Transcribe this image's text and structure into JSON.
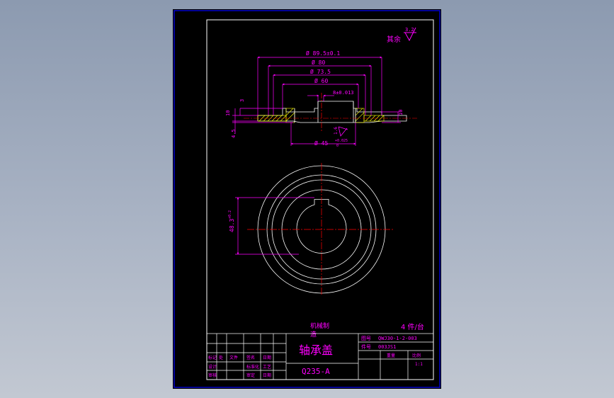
{
  "drawing": {
    "roughness_rest": "其余",
    "roughness_rest_value": "3.2",
    "roughness_face_value": "1.6",
    "dim_outer_flange": "Ø 89.5±0.1",
    "dim_bolt_circle": "Ø 80",
    "dim_spigot": "Ø 73.5",
    "dim_hub": "Ø 60",
    "dim_keyway_width": "8±0.013",
    "dim_bore": "Ø 45",
    "dim_bore_tol_upper": "+0.025",
    "dim_bore_tol_lower": "0",
    "dim_height_left": "10",
    "dim_step_left": "3",
    "dim_bottom_left": "4.5",
    "dim_height_right": "10",
    "dim_keyway_depth": "48.3",
    "dim_keyway_depth_tol": "+0.2"
  },
  "titleblock": {
    "machine_name": "机械制",
    "machine_name2": "造",
    "quantity": "4 件/台",
    "part_name": "轴承盖",
    "material": "Q235-A",
    "drawing_no_label": "图号",
    "drawing_no": "QWJ30-1-2-003",
    "part_no_label": "件号",
    "part_no": "003JS1",
    "scale": "1:1",
    "header_weight": "重量",
    "header_scale": "比例",
    "sign_row1": [
      "标记",
      "处",
      "文件",
      "签名",
      "日期"
    ],
    "sign_row2": [
      "设计",
      "",
      "标准化"
    ],
    "sign_row3": [
      "审核",
      "",
      "审定"
    ],
    "sign_row4": [
      "工艺",
      "",
      "日期"
    ]
  },
  "colors": {
    "background": "#000000",
    "geometry": "#ffffff",
    "dimension": "#ff00ff",
    "centerline": "#ff0000",
    "hatch": "#ffff00",
    "border": "#0000ff"
  }
}
